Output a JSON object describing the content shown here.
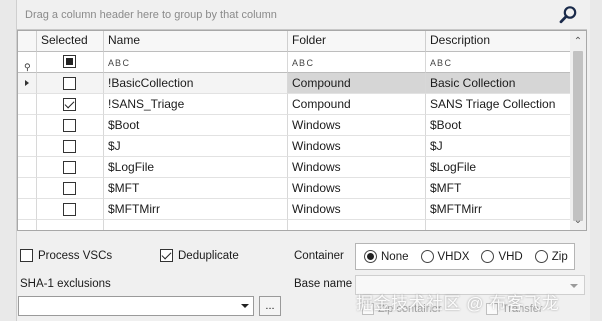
{
  "group_panel": {
    "hint": "Drag a column header here to group by that column"
  },
  "columns": {
    "selected": "Selected",
    "name": "Name",
    "folder": "Folder",
    "description": "Description"
  },
  "filter_glyph": "A B C",
  "rows": [
    {
      "selected": false,
      "name": "!BasicCollection",
      "folder": "Compound",
      "description": "Basic Collection",
      "current": true
    },
    {
      "selected": true,
      "name": "!SANS_Triage",
      "folder": "Compound",
      "description": "SANS Triage Collection",
      "current": false
    },
    {
      "selected": false,
      "name": "$Boot",
      "folder": "Windows",
      "description": "$Boot",
      "current": false
    },
    {
      "selected": false,
      "name": "$J",
      "folder": "Windows",
      "description": "$J",
      "current": false
    },
    {
      "selected": false,
      "name": "$LogFile",
      "folder": "Windows",
      "description": "$LogFile",
      "current": false
    },
    {
      "selected": false,
      "name": "$MFT",
      "folder": "Windows",
      "description": "$MFT",
      "current": false
    },
    {
      "selected": false,
      "name": "$MFTMirr",
      "folder": "Windows",
      "description": "$MFTMirr",
      "current": false
    }
  ],
  "options": {
    "process_vscs": {
      "label": "Process VSCs",
      "checked": false
    },
    "deduplicate": {
      "label": "Deduplicate",
      "checked": true
    }
  },
  "container": {
    "label": "Container",
    "options": [
      "None",
      "VHDX",
      "VHD",
      "Zip"
    ],
    "selected": "None"
  },
  "sha1": {
    "label": "SHA-1 exclusions",
    "value": "",
    "browse": "..."
  },
  "base_name": {
    "label": "Base name",
    "value": ""
  },
  "faded_options": {
    "zip_container": "Zip container",
    "transfer": "Transfer"
  },
  "watermark": "掘金技术社区 @ 布客飞龙",
  "colors": {
    "current_row": "#d6d6d6",
    "grid_border": "#a8a8a8",
    "background": "#f0f0f0"
  }
}
